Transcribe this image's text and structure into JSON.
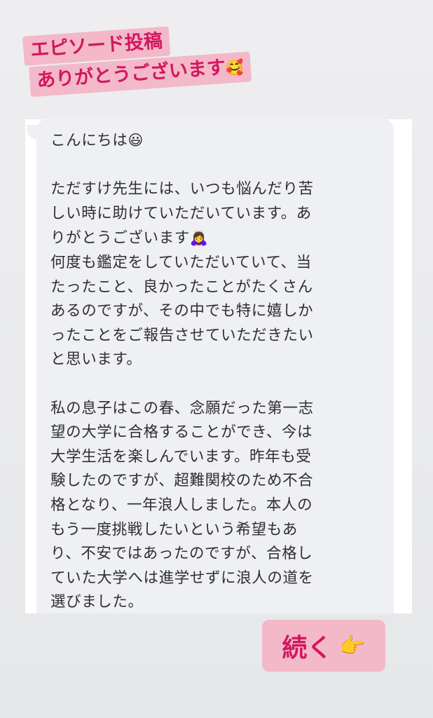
{
  "headline": {
    "line1": "エピソード投稿",
    "line2": "ありがとうございます",
    "line2_emoji": "🥰",
    "accent_color": "#d2175f",
    "highlight_color": "#f3b9c9"
  },
  "message": {
    "greeting": "こんにちは",
    "greeting_emoji": "😃",
    "p1_l1": "ただすけ先生には、いつも悩んだり苦",
    "p1_l2": "しい時に助けていただいています。あ",
    "p1_l3": "りがとうございます",
    "p1_l3_emoji": "🙇‍♀️",
    "p1_l4": "何度も鑑定をしていただいていて、当",
    "p1_l5": "たったこと、良かったことがたくさん",
    "p1_l6": "あるのですが、その中でも特に嬉しか",
    "p1_l7": "ったことをご報告させていただきたい",
    "p1_l8": "と思います。",
    "p2_l1": "私の息子はこの春、念願だった第一志",
    "p2_l2": "望の大学に合格することができ、今は",
    "p2_l3": "大学生活を楽しんでいます。昨年も受",
    "p2_l4": "験したのですが、超難関校のため不合",
    "p2_l5": "格となり、一年浪人しました。本人の",
    "p2_l6": "もう一度挑戦したいという希望もあ",
    "p2_l7": "り、不安ではあったのですが、合格し",
    "p2_l8": "ていた大学へは進学せずに浪人の道を",
    "p2_l9": "選びました。"
  },
  "continue": {
    "label": "続く",
    "emoji": "👉"
  }
}
